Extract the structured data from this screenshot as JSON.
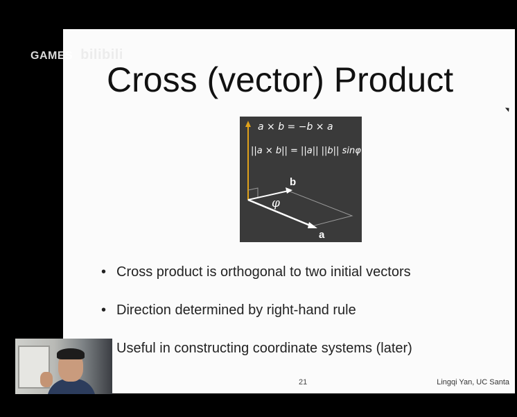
{
  "watermark": {
    "channel": "GAMES",
    "logo_text": "bilibili"
  },
  "slide": {
    "title": "Cross (vector) Product",
    "figure": {
      "formula_1": "a × b = −b × a",
      "formula_2": "||a × b|| = ||a|| ||b|| sinφ",
      "label_b": "b",
      "label_a": "a",
      "label_phi": "φ"
    },
    "bullets": [
      "Cross product is orthogonal to two initial vectors",
      "Direction determined by right-hand rule",
      "Useful in constructing coordinate systems (later)"
    ],
    "page_number": "21",
    "author": "Lingqi Yan, UC Santa"
  },
  "colors": {
    "slide_bg": "#fbfbfb",
    "figure_bg": "#3a3a3a",
    "up_vector": "#e0a21a"
  }
}
